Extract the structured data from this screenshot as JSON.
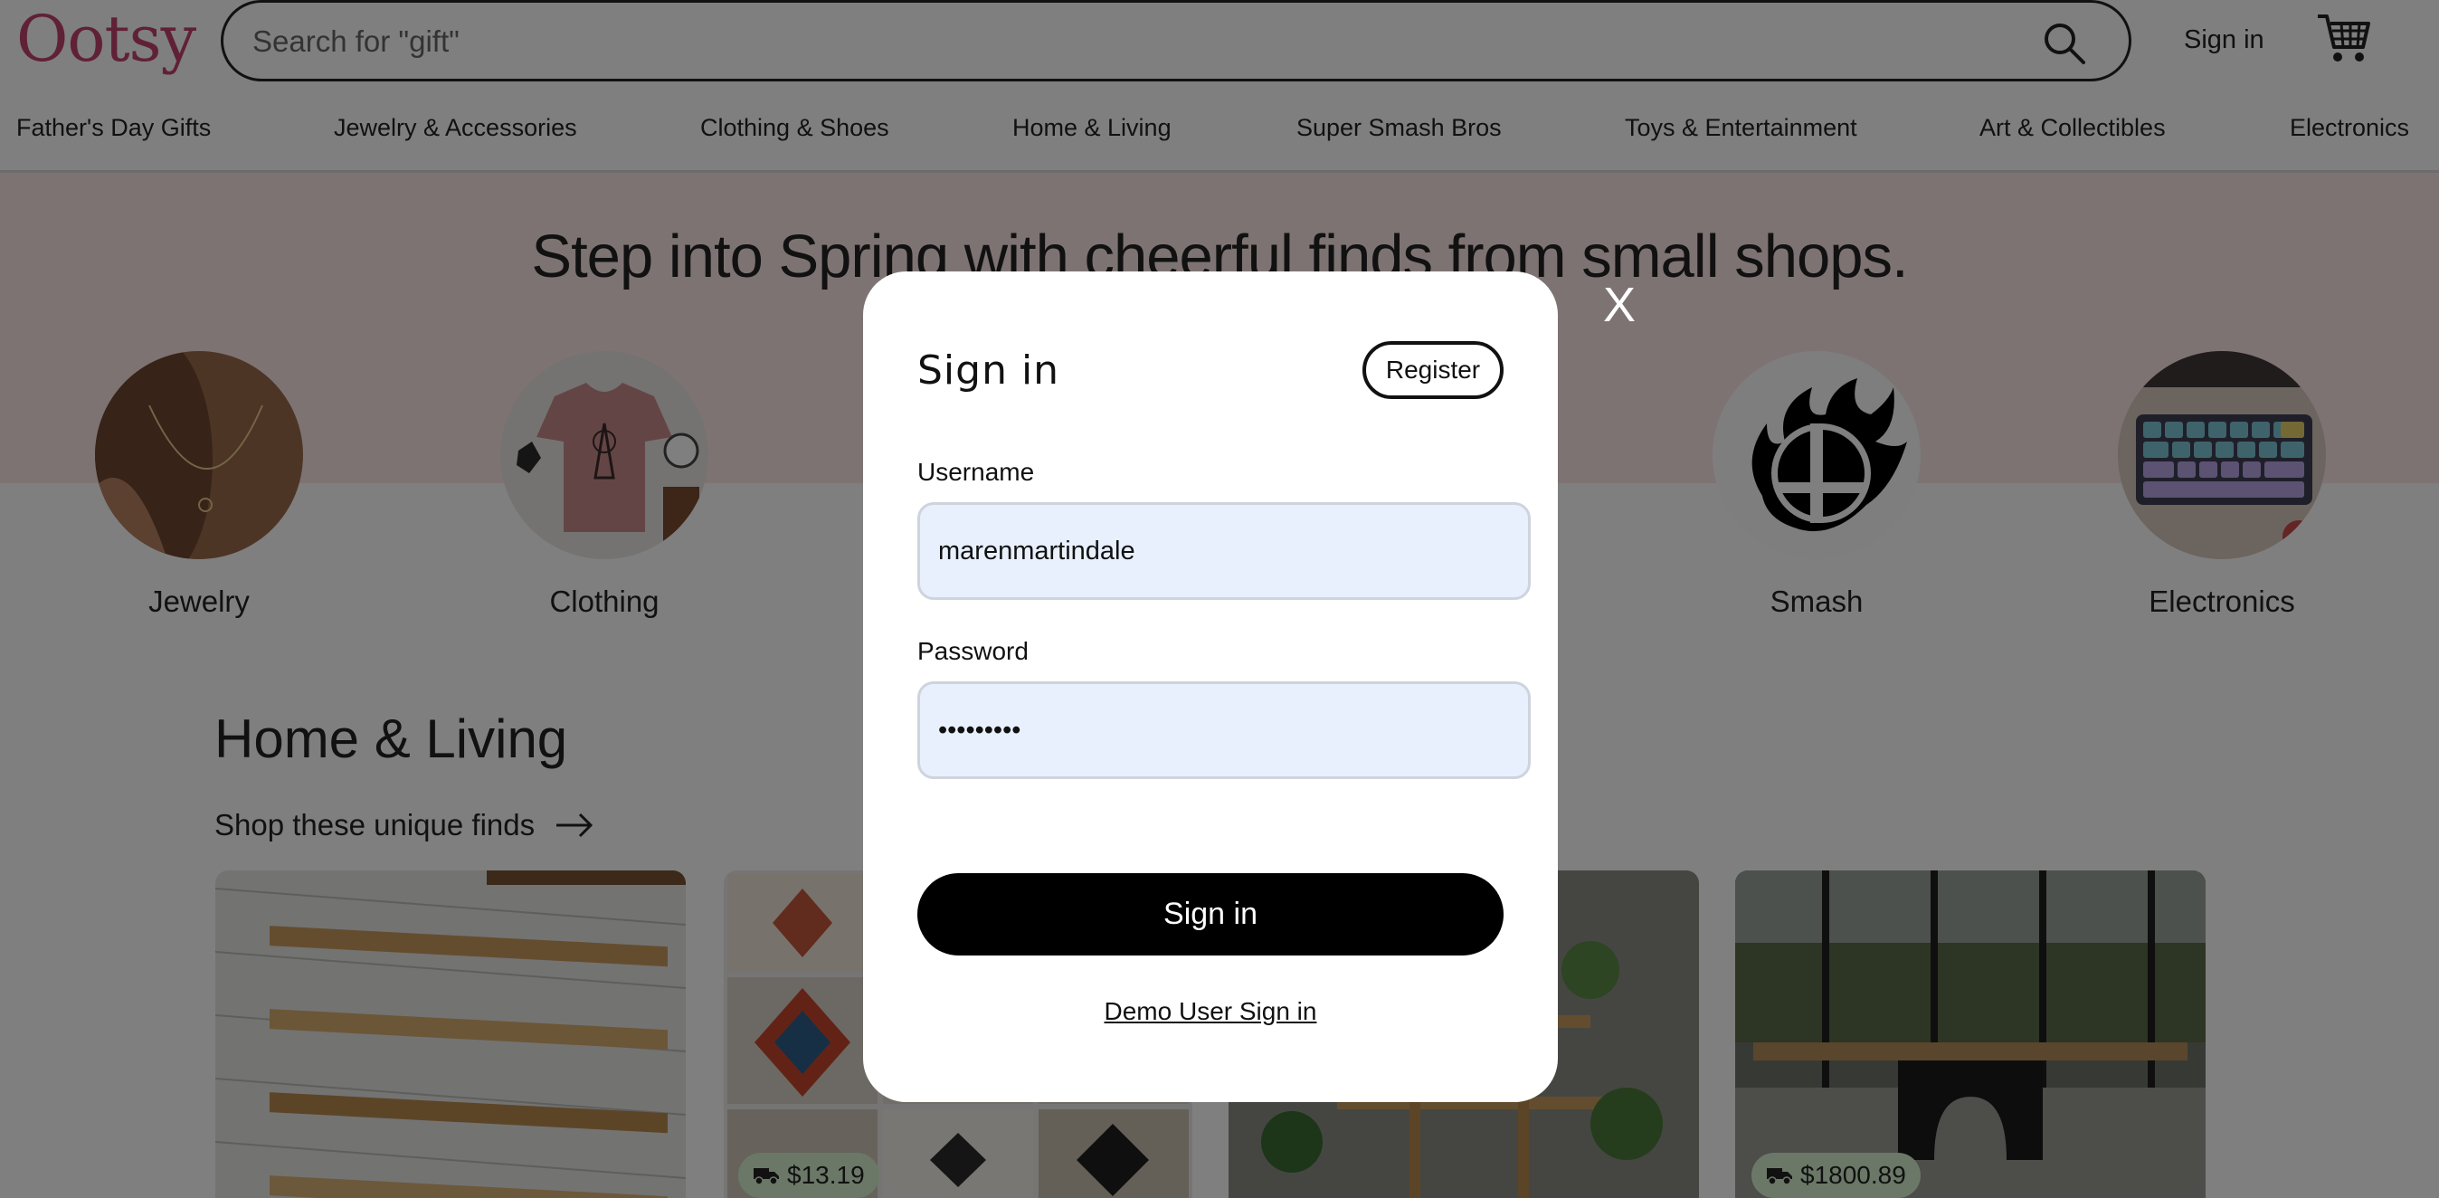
{
  "header": {
    "logo": "Ootsy",
    "search_placeholder": "Search for \"gift\"",
    "signin_label": "Sign in",
    "brand_color": "#c0436f"
  },
  "nav": {
    "categories": [
      "Father's Day Gifts",
      "Jewelry & Accessories",
      "Clothing & Shoes",
      "Home & Living",
      "Super Smash Bros",
      "Toys & Entertainment",
      "Art & Collectibles",
      "Electronics"
    ]
  },
  "hero": {
    "title": "Step into Spring with cheerful finds from small shops.",
    "background_color": "#fde7e6",
    "circles": [
      {
        "label": "Jewelry"
      },
      {
        "label": "Clothing"
      },
      {
        "label": "Smash"
      },
      {
        "label": "Electronics"
      }
    ]
  },
  "section": {
    "title": "Home & Living",
    "subtitle": "Shop these unique finds",
    "cards": [
      {
        "price": ""
      },
      {
        "price": "$13.19"
      },
      {
        "price": ""
      },
      {
        "price": "$1800.89"
      }
    ]
  },
  "modal": {
    "close_label": "X",
    "title": "Sign in",
    "register_label": "Register",
    "username_label": "Username",
    "username_value": "marenmartindale",
    "password_label": "Password",
    "password_value": "password1",
    "submit_label": "Sign in",
    "demo_label": "Demo User Sign in"
  }
}
